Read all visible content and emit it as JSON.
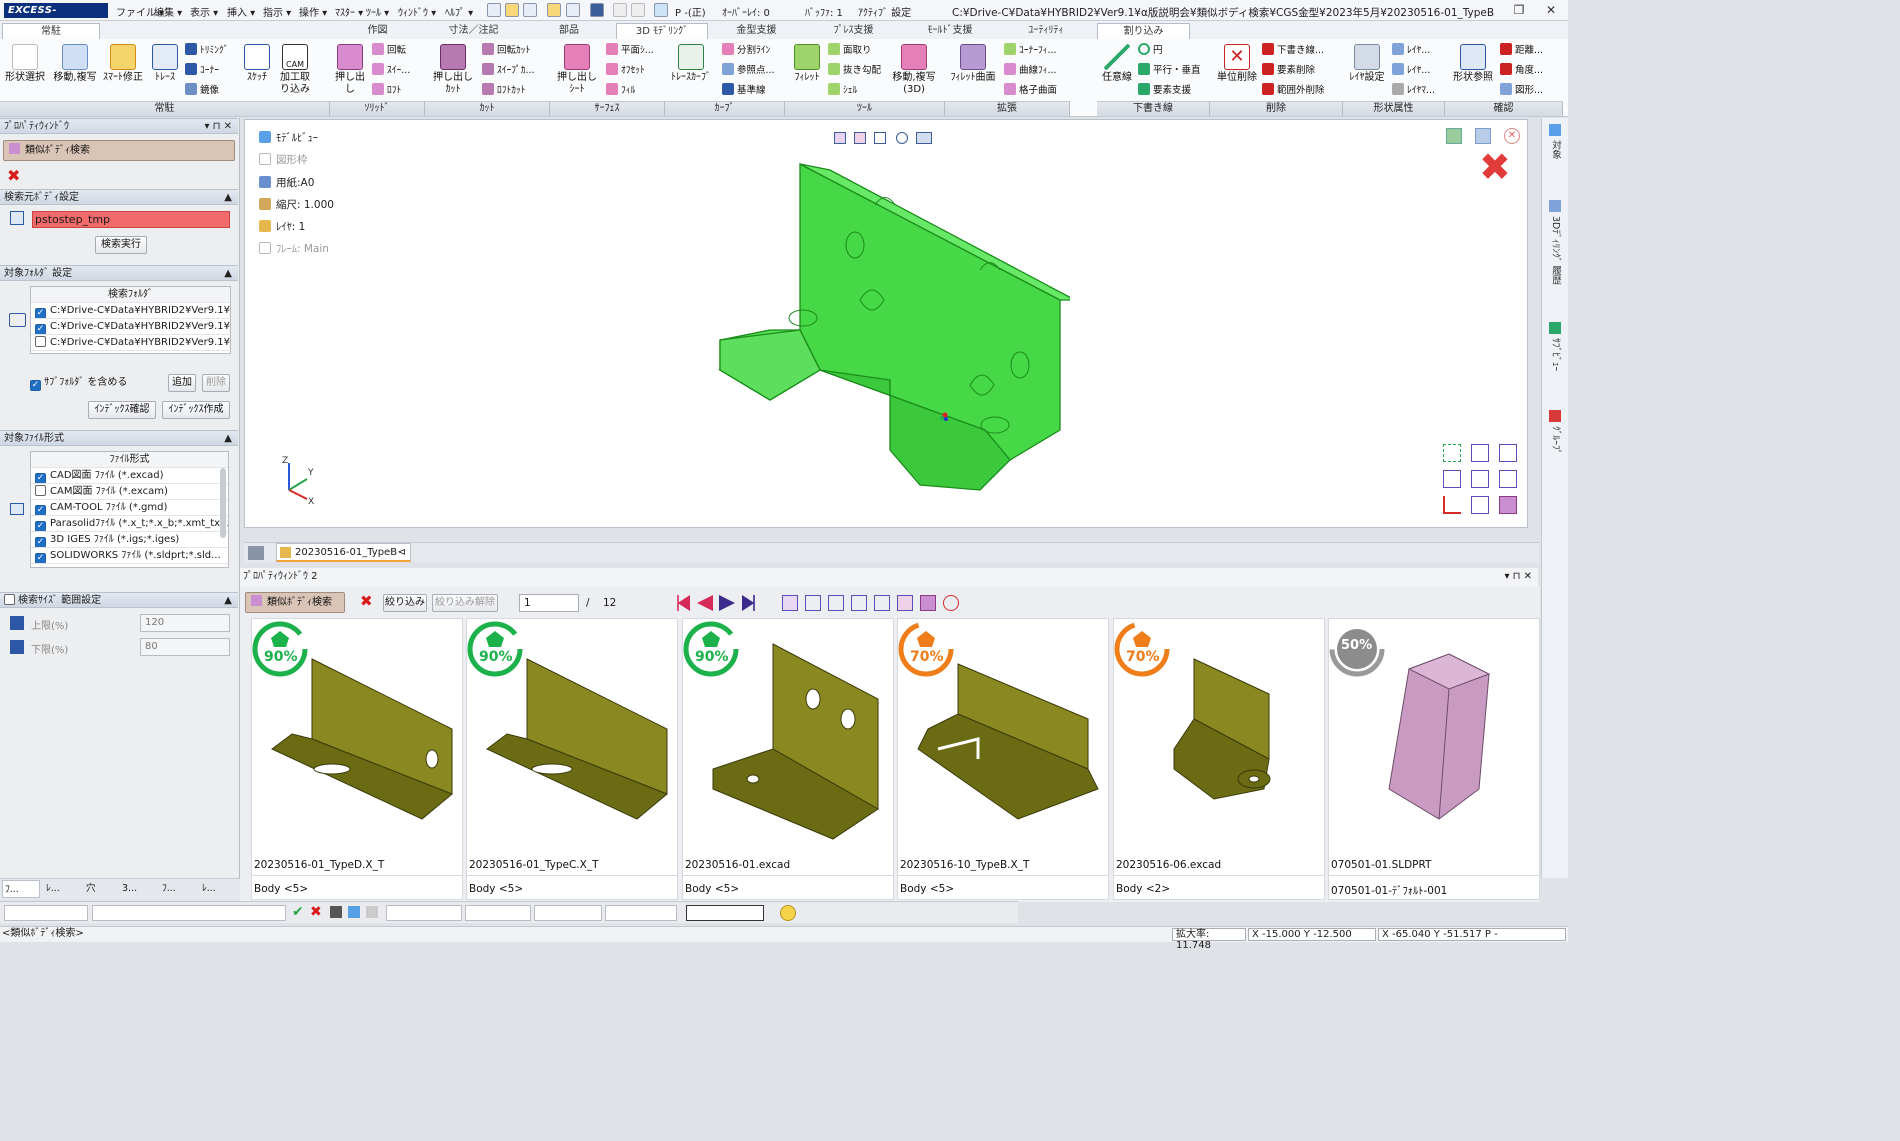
{
  "titlebar": {
    "logo": "EXCESS-HYBRIDⅡ",
    "menus": [
      "ファイル ▾",
      "編集 ▾",
      "表示 ▾",
      "挿入 ▾",
      "指示 ▾",
      "操作 ▾",
      "ﾏｽﾀｰ ▾",
      "ﾂｰﾙ ▾",
      "ｳｨﾝﾄﾞｳ ▾",
      "ﾍﾙﾌﾟ ▾"
    ],
    "tool_p": "P -(正)",
    "overlay": "ｵｰﾊﾞｰﾚｲ: 0",
    "buffer": "ﾊﾞｯﾌｧ: 1",
    "active_settings": "ｱｸﾃｨﾌﾞ 設定",
    "path": "C:¥Drive-C¥Data¥HYBRID2¥Ver9.1¥α版説明会¥類似ボディ検索¥CGS金型¥2023年5月¥20230516-01_TypeB",
    "restore": "❐",
    "close": "✕"
  },
  "ribbon": {
    "tabs": [
      "常駐",
      "作図",
      "寸法／注記",
      "部品",
      "3D ﾓﾃﾞﾘﾝｸﾞ",
      "金型支援",
      "ﾌﾟﾚｽ支援",
      "ﾓｰﾙﾄﾞ支援",
      "ﾕｰﾃｨﾘﾃｨ",
      "割り込み"
    ],
    "group_labels": [
      "常駐",
      "ｿﾘｯﾄﾞ",
      "ｶｯﾄ",
      "ｻｰﾌｪｽ",
      "ｶｰﾌﾞ",
      "ﾂｰﾙ",
      "拡張",
      "下書き線",
      "削除",
      "形状属性",
      "確認"
    ],
    "jochu": [
      "形状選択",
      "移動,複写",
      "ｽﾏｰﾄ修正",
      "ﾄﾚｰｽ"
    ],
    "jochu_small": [
      "ﾄﾘﾐﾝｸﾞ",
      "ｺｰﾅｰ",
      "鏡像"
    ],
    "sketch": [
      "ｽｹｯﾁ",
      "加工取り込み"
    ],
    "cam_label": "CAM",
    "solid_big": "押し出し",
    "solid_small": [
      "回転",
      "ｽｲｰ...",
      "ﾛﾌﾄ"
    ],
    "cut_big": "押し出しｶｯﾄ",
    "cut_small": [
      "回転ｶｯﾄ",
      "ｽｲｰﾌﾟｶ...",
      "ﾛﾌﾄｶｯﾄ"
    ],
    "surf_big": "押し出しｼｰﾄ",
    "surf_small": [
      "平面ｼ...",
      "ｵﾌｾｯﾄ",
      "ﾌｨﾙ"
    ],
    "curve_big": "ﾄﾚｰｽｶｰﾌﾞ",
    "curve_small": [
      "分割ﾗｲﾝ",
      "参照点...",
      "基準線"
    ],
    "tool_big": "ﾌｨﾚｯﾄ",
    "tool_small": [
      "面取り",
      "抜き勾配",
      "ｼｪﾙ"
    ],
    "tool_big2": "移動,複写(3D)",
    "ext_big": "ﾌｨﾚｯﾄ曲面",
    "ext_small": [
      "ｺｰﾅｰﾌｨ...",
      "曲線ﾌｨ...",
      "格子曲面"
    ],
    "draft_big": "任意線",
    "draft_small": [
      "円",
      "平行・垂直",
      "要素支援"
    ],
    "del_big": "単位削除",
    "del_small": [
      "下書き線...",
      "要素削除",
      "範囲外削除"
    ],
    "attr_big": "ﾚｲﾔ設定",
    "attr_small": [
      "ﾚｲﾔ...",
      "ﾚｲﾔ...",
      "ﾚｲﾔﾏ..."
    ],
    "confirm_big": "形状参照",
    "confirm_small": [
      "距離...",
      "角度...",
      "図形..."
    ]
  },
  "leftpanel": {
    "header": "ﾌﾟﾛﾊﾟﾃｨｳｨﾝﾄﾞｳ",
    "search_title": "類似ﾎﾞﾃﾞｨ検索",
    "src_section": "検索元ﾎﾞﾃﾞｨ設定",
    "src_body": "pstostep_tmp",
    "search_exec": "検索実行",
    "folder_section": "対象ﾌｫﾙﾀﾞ 設定",
    "folder_col": "検索ﾌｫﾙﾀﾞ",
    "folders": [
      {
        "path": "C:¥Drive-C¥Data¥HYBRID2¥Ver9.1¥...",
        "checked": true
      },
      {
        "path": "C:¥Drive-C¥Data¥HYBRID2¥Ver9.1¥...",
        "checked": true
      },
      {
        "path": "C:¥Drive-C¥Data¥HYBRID2¥Ver9.1¥...",
        "checked": false
      }
    ],
    "include_sub": "ｻﾌﾞﾌｫﾙﾀﾞ を含める",
    "add": "追加",
    "del": "削除",
    "idx_check": "ｲﾝﾃﾞｯｸｽ確認",
    "idx_make": "ｲﾝﾃﾞｯｸｽ作成",
    "format_section": "対象ﾌｧｲﾙ形式",
    "format_col": "ﾌｧｲﾙ形式",
    "formats": [
      {
        "label": "CAD図面 ﾌｧｲﾙ (*.excad)",
        "checked": true
      },
      {
        "label": "CAM図面 ﾌｧｲﾙ (*.excam)",
        "checked": false
      },
      {
        "label": "CAM-TOOL ﾌｧｲﾙ (*.gmd)",
        "checked": true
      },
      {
        "label": "Parasolidﾌｧｲﾙ (*.x_t;*.x_b;*.xmt_tx...",
        "checked": true
      },
      {
        "label": "3D IGES ﾌｧｲﾙ (*.igs;*.iges)",
        "checked": true
      },
      {
        "label": "SOLIDWORKS ﾌｧｲﾙ (*.sldprt;*.sld...",
        "checked": true
      }
    ],
    "size_section": "検索ｻｲｽﾞ 範囲設定",
    "upper_label": "上限(%)",
    "upper_val": "120",
    "lower_label": "下限(%)",
    "lower_val": "80",
    "bottom_tabs": [
      "ﾌ...",
      "ﾚ...",
      "穴",
      "3...",
      "ﾌ...",
      "ﾚ..."
    ]
  },
  "viewport": {
    "model_view": "ﾓﾃﾞﾙﾋﾞｭｰ",
    "frame": "図形枠",
    "paper": "用紙:A0",
    "scale": "縮尺: 1.000",
    "layer": "ﾚｲﾔ: 1",
    "frame_main": "ﾌﾚｰﾑ: Main",
    "axes": {
      "x": "X",
      "y": "Y",
      "z": "Z"
    }
  },
  "doctab": {
    "label": "20230516-01_TypeB",
    "pin": "⊲"
  },
  "rightstrip": {
    "labels": [
      "対象",
      "3Dﾃﾞｨﾘﾝｸﾞ 履歴",
      "ｻﾌﾞﾋﾞｭｰ",
      "ｸﾞﾙｰﾌﾟ"
    ]
  },
  "pw2": {
    "header": "ﾌﾟﾛﾊﾟﾃｨｳｨﾝﾄﾞｳ 2",
    "title": "類似ﾎﾞﾃﾞｨ検索",
    "filter": "絞り込み",
    "unfilter": "絞り込み解除",
    "page": "1",
    "total": "12",
    "results": [
      {
        "pct": "90%",
        "name": "20230516-01_TypeD.X_T",
        "body": "Body <5>",
        "color": "#1db14b"
      },
      {
        "pct": "90%",
        "name": "20230516-01_TypeC.X_T",
        "body": "Body <5>",
        "color": "#1db14b"
      },
      {
        "pct": "90%",
        "name": "20230516-01.excad",
        "body": "Body <5>",
        "color": "#1db14b"
      },
      {
        "pct": "70%",
        "name": "20230516-10_TypeB.X_T",
        "body": "Body <5>",
        "color": "#ef7d1a"
      },
      {
        "pct": "70%",
        "name": "20230516-06.excad",
        "body": "Body <2>",
        "color": "#ef7d1a"
      },
      {
        "pct": "50%",
        "name": "070501-01.SLDPRT",
        "body": "070501-01-ﾃﾞﾌｫﾙﾄ-001",
        "color": "#8c8c8c"
      }
    ]
  },
  "statusbar": {
    "prompt": "<類似ﾎﾞﾃﾞｨ検索>",
    "zoom": "拡大率: 11.748",
    "xy1": "X -15.000 Y -12.500",
    "xy2": "X -65.040 Y -51.517  P -"
  },
  "colors": {
    "accent": "#1f6fc4",
    "green_model": "#3fc93f",
    "olive_model": "#6b6b14",
    "pink_box": "#c99ac2",
    "highlight_field": "#f26b6b"
  }
}
